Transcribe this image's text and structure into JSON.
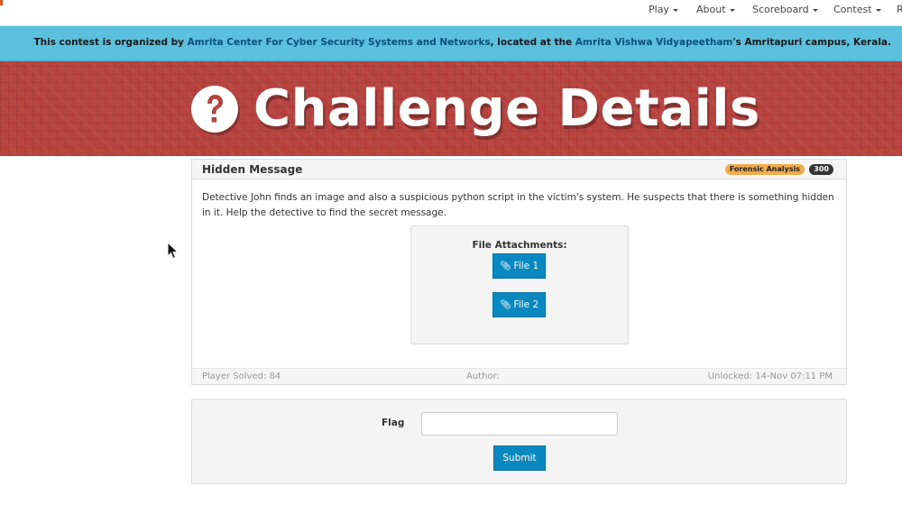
{
  "nav": {
    "items": [
      {
        "label": "Play"
      },
      {
        "label": "About"
      },
      {
        "label": "Scoreboard"
      },
      {
        "label": "Contest"
      },
      {
        "label": "R"
      }
    ]
  },
  "info": {
    "prefix": "This contest is organized by ",
    "org": "Amrita Center For Cyber Security Systems and Networks",
    "middle": ", located at the ",
    "university": "Amrita Vishwa Vidyapeetham",
    "suffix": "'s Amritapuri campus, Kerala."
  },
  "banner": {
    "icon": "question-circle-icon",
    "title": "Challenge Details"
  },
  "challenge": {
    "title": "Hidden Message",
    "category": "Forensic Analysis",
    "points": "300",
    "description": "Detective John finds an image and also a suspicious python script in the victim's system. He suspects that there is something hidden in it. Help the detective to find the secret message.",
    "attachments_label": "File Attachments:",
    "files": [
      {
        "label": "File 1",
        "icon": "paperclip-icon"
      },
      {
        "label": "File 2",
        "icon": "paperclip-icon"
      }
    ],
    "footer": {
      "solved": "Player Solved: 84",
      "author": "Author:",
      "unlocked": "Unlocked: 14-Nov 07:11 PM"
    }
  },
  "flag_form": {
    "label": "Flag",
    "value": "",
    "submit": "Submit"
  },
  "colors": {
    "info_bar": "#5bc0de",
    "banner": "#b8433f",
    "primary_button": "#0a88c0",
    "category_badge": "#f0ad4e"
  }
}
